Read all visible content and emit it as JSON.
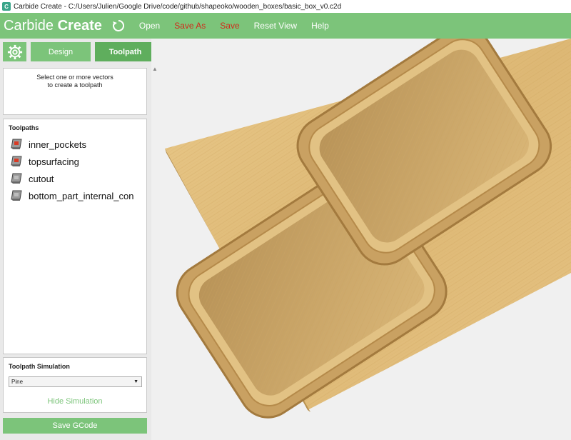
{
  "window": {
    "title": "Carbide Create - C:/Users/Julien/Google Drive/code/github/shapeoko/wooden_boxes/basic_box_v0.c2d",
    "icon": "carbide-app-icon"
  },
  "header": {
    "brand_light": "Carbide ",
    "brand_bold": "Create",
    "menu": [
      {
        "label": "Open"
      },
      {
        "label": "Save As"
      },
      {
        "label": "Save"
      },
      {
        "label": "Reset View"
      },
      {
        "label": "Help"
      }
    ]
  },
  "tabs": {
    "design": "Design",
    "toolpath": "Toolpath",
    "active": "Toolpath"
  },
  "info": {
    "line1": "Select one or more vectors",
    "line2": "to create a toolpath"
  },
  "toolpaths": {
    "title": "Toolpaths",
    "items": [
      {
        "label": "inner_pockets",
        "icon": "toolpath-pocket-icon"
      },
      {
        "label": "topsurfacing",
        "icon": "toolpath-surface-icon"
      },
      {
        "label": "cutout",
        "icon": "toolpath-cutout-icon"
      },
      {
        "label": "bottom_part_internal_con",
        "icon": "toolpath-contour-icon"
      }
    ]
  },
  "simulation": {
    "title": "Toolpath Simulation",
    "material": "Pine",
    "hide_label": "Hide Simulation"
  },
  "actions": {
    "save_gcode": "Save GCode"
  },
  "colors": {
    "brand_green": "#7cc47a",
    "active_tab": "#5fae5d",
    "warn_red": "#d12b1b",
    "wood": "#e3c07a"
  }
}
